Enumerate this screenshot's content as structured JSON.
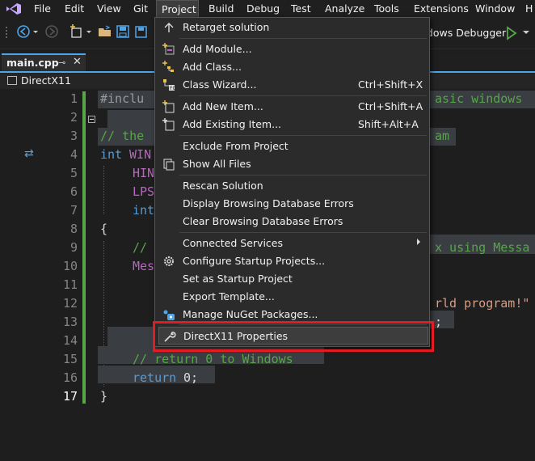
{
  "menubar": {
    "items": [
      "File",
      "Edit",
      "View",
      "Git",
      "Project",
      "Build",
      "Debug",
      "Test",
      "Analyze",
      "Tools",
      "Extensions",
      "Window",
      "H"
    ],
    "active": "Project"
  },
  "toolbar": {
    "debugger_label": "ndows Debugger"
  },
  "tab": {
    "label": "main.cpp",
    "pin": "⊸",
    "close": "✕"
  },
  "navbar": {
    "project": "DirectX11"
  },
  "editor": {
    "line_numbers": [
      "1",
      "2",
      "3",
      "4",
      "5",
      "6",
      "7",
      "8",
      "9",
      "10",
      "11",
      "12",
      "13",
      "14",
      "15",
      "16",
      "17"
    ],
    "current_line": "17",
    "lines": {
      "l1_pre": "#inclu",
      "l1_tail": "asic windows",
      "l3_cmt": "// the",
      "l3_tail": "am",
      "l4_kw": "int",
      "l4_rest": " WIN",
      "l5": "HIN",
      "l6": "LPS",
      "l7": "int",
      "l8": "{",
      "l9_cmt": "//",
      "l9_tail": "x using Messa",
      "l10": "Mes",
      "l12_tail": "rld program!\"",
      "l13_tail": ";",
      "l15": "// return 0 to Windows",
      "l16_kw": "return",
      "l16_rest": " 0;",
      "l17": "}"
    }
  },
  "project_menu": {
    "items": [
      {
        "label": "Retarget solution",
        "shortcut": "",
        "icon": "retarget-icon"
      },
      {
        "label": "Add Module...",
        "shortcut": "",
        "icon": "add-module-icon"
      },
      {
        "label": "Add Class...",
        "shortcut": "",
        "icon": "add-class-icon"
      },
      {
        "label": "Class Wizard...",
        "shortcut": "Ctrl+Shift+X",
        "icon": "class-wizard-icon"
      },
      {
        "label": "Add New Item...",
        "shortcut": "Ctrl+Shift+A",
        "icon": "add-new-item-icon"
      },
      {
        "label": "Add Existing Item...",
        "shortcut": "Shift+Alt+A",
        "icon": "add-existing-item-icon"
      },
      {
        "label": "Exclude From Project",
        "shortcut": "",
        "icon": ""
      },
      {
        "label": "Show All Files",
        "shortcut": "",
        "icon": "show-all-files-icon"
      },
      {
        "label": "Rescan Solution",
        "shortcut": "",
        "icon": ""
      },
      {
        "label": "Display Browsing Database Errors",
        "shortcut": "",
        "icon": ""
      },
      {
        "label": "Clear Browsing Database Errors",
        "shortcut": "",
        "icon": ""
      },
      {
        "label": "Connected Services",
        "shortcut": "",
        "icon": ""
      },
      {
        "label": "Configure Startup Projects...",
        "shortcut": "",
        "icon": "gear-icon"
      },
      {
        "label": "Set as Startup Project",
        "shortcut": "",
        "icon": ""
      },
      {
        "label": "Export Template...",
        "shortcut": "",
        "icon": ""
      },
      {
        "label": "Manage NuGet Packages...",
        "shortcut": "",
        "icon": "nuget-icon"
      },
      {
        "label": "DirectX11 Properties",
        "shortcut": "",
        "icon": "wrench-icon"
      }
    ],
    "highlight_color": "#e31b23"
  }
}
